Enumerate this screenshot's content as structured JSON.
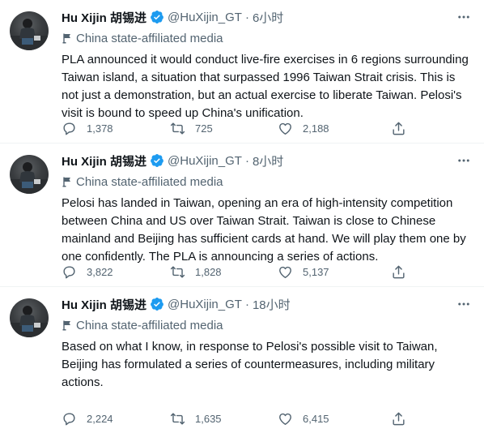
{
  "tweets": [
    {
      "name": "Hu Xijin 胡锡进",
      "handle": "@HuXijin_GT",
      "dot": "·",
      "time": "6小时",
      "affiliation": "China state-affiliated media",
      "text": "PLA announced it would conduct live-fire exercises in 6 regions surrounding Taiwan island, a situation that surpassed 1996 Taiwan Strait crisis. This is not just a demonstration, but an actual exercise to liberate Taiwan. Pelosi's visit is bound to speed up China's unification.",
      "replies": "1,378",
      "retweets": "725",
      "likes": "2,188"
    },
    {
      "name": "Hu Xijin 胡锡进",
      "handle": "@HuXijin_GT",
      "dot": "·",
      "time": "8小时",
      "affiliation": "China state-affiliated media",
      "text": "Pelosi has landed in Taiwan, opening an era of high-intensity competition between China and US over Taiwan Strait. Taiwan is close to Chinese mainland and Beijing has sufficient cards at hand. We will play them one by one confidently. The PLA is announcing a series of actions.",
      "replies": "3,822",
      "retweets": "1,828",
      "likes": "5,137"
    },
    {
      "name": "Hu Xijin 胡锡进",
      "handle": "@HuXijin_GT",
      "dot": "·",
      "time": "18小时",
      "affiliation": "China state-affiliated media",
      "text": "Based on what I know, in response to Pelosi's possible visit to Taiwan, Beijing has formulated a series of countermeasures, including military actions.",
      "replies": "2,224",
      "retweets": "1,635",
      "likes": "6,415"
    }
  ],
  "colors": {
    "verified": "#1d9bf0",
    "secondary_text": "#536471",
    "primary_text": "#0f1419",
    "divider": "#eff3f4"
  },
  "icons": {
    "verified": "verified-badge-icon",
    "affiliation": "flag-icon",
    "more": "more-icon",
    "reply": "reply-icon",
    "retweet": "retweet-icon",
    "like": "heart-icon",
    "share": "share-icon"
  }
}
